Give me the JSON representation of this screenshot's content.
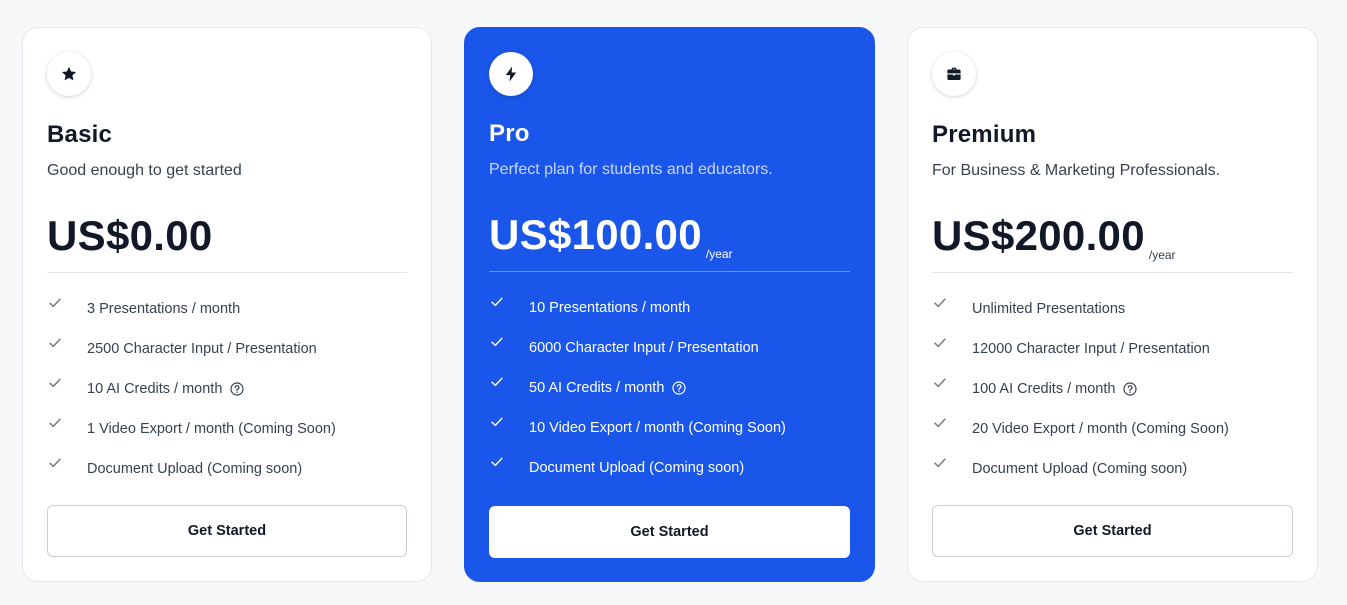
{
  "plans": [
    {
      "icon": "star-icon",
      "name": "Basic",
      "description": "Good enough to get started",
      "price": "US$0.00",
      "period": "",
      "features": [
        {
          "text": "3 Presentations / month",
          "help": false
        },
        {
          "text": "2500 Character Input / Presentation",
          "help": false
        },
        {
          "text": "10 AI Credits / month",
          "help": true
        },
        {
          "text": "1 Video Export / month (Coming Soon)",
          "help": false
        },
        {
          "text": "Document Upload (Coming soon)",
          "help": false
        }
      ],
      "cta": "Get Started"
    },
    {
      "icon": "lightning-icon",
      "name": "Pro",
      "description": "Perfect plan for students and educators.",
      "price": "US$100.00",
      "period": "/year",
      "features": [
        {
          "text": "10 Presentations / month",
          "help": false
        },
        {
          "text": "6000 Character Input / Presentation",
          "help": false
        },
        {
          "text": "50 AI Credits / month",
          "help": true
        },
        {
          "text": "10 Video Export / month (Coming Soon)",
          "help": false
        },
        {
          "text": "Document Upload (Coming soon)",
          "help": false
        }
      ],
      "cta": "Get Started"
    },
    {
      "icon": "briefcase-icon",
      "name": "Premium",
      "description": "For Business & Marketing Professionals.",
      "price": "US$200.00",
      "period": "/year",
      "features": [
        {
          "text": "Unlimited Presentations",
          "help": false
        },
        {
          "text": "12000 Character Input / Presentation",
          "help": false
        },
        {
          "text": "100 AI Credits / month",
          "help": true
        },
        {
          "text": "20 Video Export / month (Coming Soon)",
          "help": false
        },
        {
          "text": "Document Upload (Coming soon)",
          "help": false
        }
      ],
      "cta": "Get Started"
    }
  ],
  "colors": {
    "highlight": "#1a56ea",
    "page_background": "#f7f8fa",
    "card_border": "#e5e7eb",
    "text_dark": "#111827",
    "text_muted": "#374151",
    "check_muted": "#6b7280"
  }
}
